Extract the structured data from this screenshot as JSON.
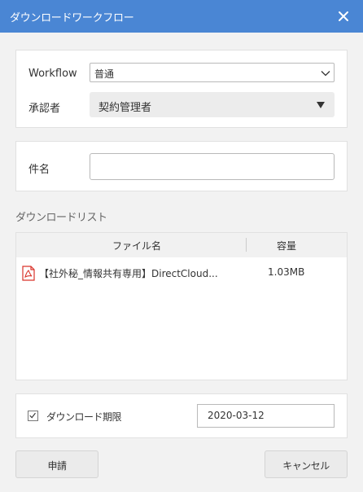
{
  "dialog": {
    "title": "ダウンロードワークフロー"
  },
  "workflow": {
    "label": "Workflow",
    "value": "普通",
    "approver_label": "承認者",
    "approver_value": "契約管理者"
  },
  "subject": {
    "label": "件名",
    "value": ""
  },
  "download_list": {
    "title": "ダウンロードリスト",
    "col_name": "ファイル名",
    "col_size": "容量",
    "rows": [
      {
        "name": "【社外秘_情報共有専用】DirectCloud...",
        "size": "1.03MB"
      }
    ]
  },
  "deadline": {
    "label": "ダウンロード期限",
    "checked": true,
    "value": "2020-03-12"
  },
  "buttons": {
    "apply": "申請",
    "cancel": "キャンセル"
  },
  "colors": {
    "titlebar": "#4a86d4",
    "pdf_icon": "#d9342b"
  }
}
